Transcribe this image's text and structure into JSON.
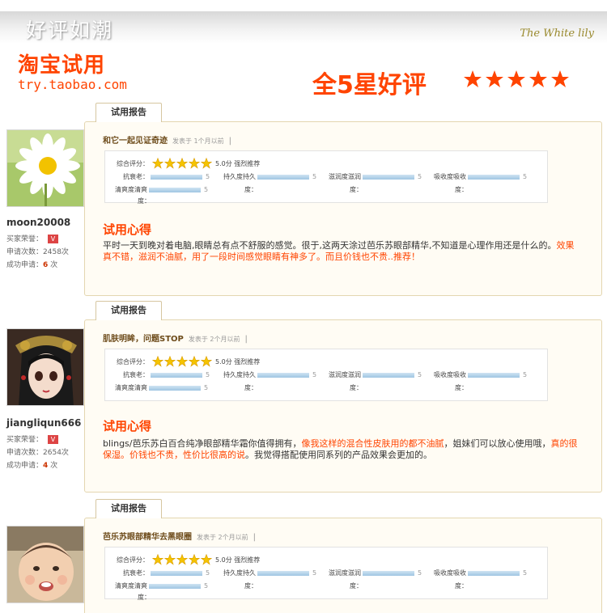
{
  "header": {
    "title": "好评如潮",
    "subtitle": "The White lily"
  },
  "logo": {
    "main": "淘宝试用",
    "url": "try.taobao.com"
  },
  "headline": {
    "text": "全5星好评",
    "stars": 5
  },
  "labels": {
    "tab": "试用报告",
    "experience": "试用心得",
    "overall": "综合评分：",
    "score": "5.0分 强烈推荐",
    "credit": "买家荣誉：",
    "apply_count": "申请次数：",
    "success_count": "成功申请：",
    "metric_anti": "抗衰老：",
    "metric_lasting": "持久度持久",
    "metric_moist": "滋润度滋润",
    "metric_absorb": "吸收度吸收",
    "metric_fresh": "清爽度清爽",
    "metric_du": "度：",
    "metric_value": "5",
    "level": "V"
  },
  "reviews": [
    {
      "user": "moon20008",
      "apply_count": "2458次",
      "success_count": "6",
      "success_unit": "次",
      "title": "和它一起见证奇迹",
      "posted": "发表于 1个月以前",
      "sep": "|",
      "text_a": "平时一天到晚对着电脑,眼睛总有点不舒服的感觉。很于,这两天涂过芭乐苏眼部精华,不知道是心理作用还是什么的。",
      "text_b": "效果真不错，滋润不油腻，用了一段时间感觉眼睛有神多了。而且价钱也不贵..推荐！",
      "text_c": ""
    },
    {
      "user": "jiangliqun666",
      "apply_count": "2654次",
      "success_count": "4",
      "success_unit": "次",
      "title": "肌肤明眸，问题STOP",
      "posted": "发表于 2个月以前",
      "sep": "|",
      "text_a": "blings/芭乐苏白百合纯净眼部精华霜你值得拥有，",
      "text_b": "像我这样的混合性皮肤用的都不油腻",
      "text_c": "，姐妹们可以放心使用哦，",
      "text_d": "真的很保湿。价钱也不贵，性价比很高的说",
      "text_e": "。我觉得搭配使用同系列的产品效果会更加的。"
    },
    {
      "user": "",
      "title": "芭乐苏眼部精华去黑眼圈",
      "posted": "发表于 2个月以前",
      "sep": "|"
    }
  ],
  "colors": {
    "accent": "#ff4400",
    "card_border": "#e4d6b0",
    "card_bg": "#fffcf4",
    "star": "#f5c400"
  }
}
